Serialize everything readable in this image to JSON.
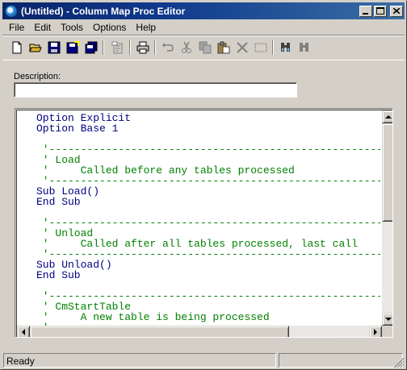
{
  "window": {
    "title": "(Untitled) - Column Map Proc Editor"
  },
  "menu": [
    "File",
    "Edit",
    "Tools",
    "Options",
    "Help"
  ],
  "toolbar": {
    "icons": [
      "new-file-icon",
      "open-folder-icon",
      "save-icon",
      "save-as-icon",
      "save-all-icon",
      "properties-icon",
      "print-icon",
      "undo-icon",
      "cut-icon",
      "copy-icon",
      "paste-icon",
      "delete-icon",
      "select-all-icon",
      "find-icon",
      "replace-icon"
    ]
  },
  "description": {
    "label": "Description:",
    "value": ""
  },
  "code": {
    "lines": [
      {
        "type": "kw",
        "text": "Option Explicit"
      },
      {
        "type": "kw",
        "text": "Option Base 1"
      },
      {
        "type": "blank",
        "text": ""
      },
      {
        "type": "cm",
        "text": " '---------------------------------------------------------------------"
      },
      {
        "type": "cm",
        "text": " ' Load"
      },
      {
        "type": "cm",
        "text": " '     Called before any tables processed"
      },
      {
        "type": "cm",
        "text": " '---------------------------------------------------------------------"
      },
      {
        "type": "kw",
        "text": "Sub Load()"
      },
      {
        "type": "kw",
        "text": "End Sub"
      },
      {
        "type": "blank",
        "text": ""
      },
      {
        "type": "cm",
        "text": " '---------------------------------------------------------------------"
      },
      {
        "type": "cm",
        "text": " ' Unload"
      },
      {
        "type": "cm",
        "text": " '     Called after all tables processed, last call"
      },
      {
        "type": "cm",
        "text": " '---------------------------------------------------------------------"
      },
      {
        "type": "kw",
        "text": "Sub Unload()"
      },
      {
        "type": "kw",
        "text": "End Sub"
      },
      {
        "type": "blank",
        "text": ""
      },
      {
        "type": "cm",
        "text": " '---------------------------------------------------------------------"
      },
      {
        "type": "cm",
        "text": " ' CmStartTable"
      },
      {
        "type": "cm",
        "text": " '     A new table is being processed"
      },
      {
        "type": "cm",
        "text": " '"
      }
    ]
  },
  "status": {
    "text": "Ready"
  },
  "colors": {
    "keyword": "#000080",
    "comment": "#008000",
    "titlebar": "#0a246a"
  }
}
